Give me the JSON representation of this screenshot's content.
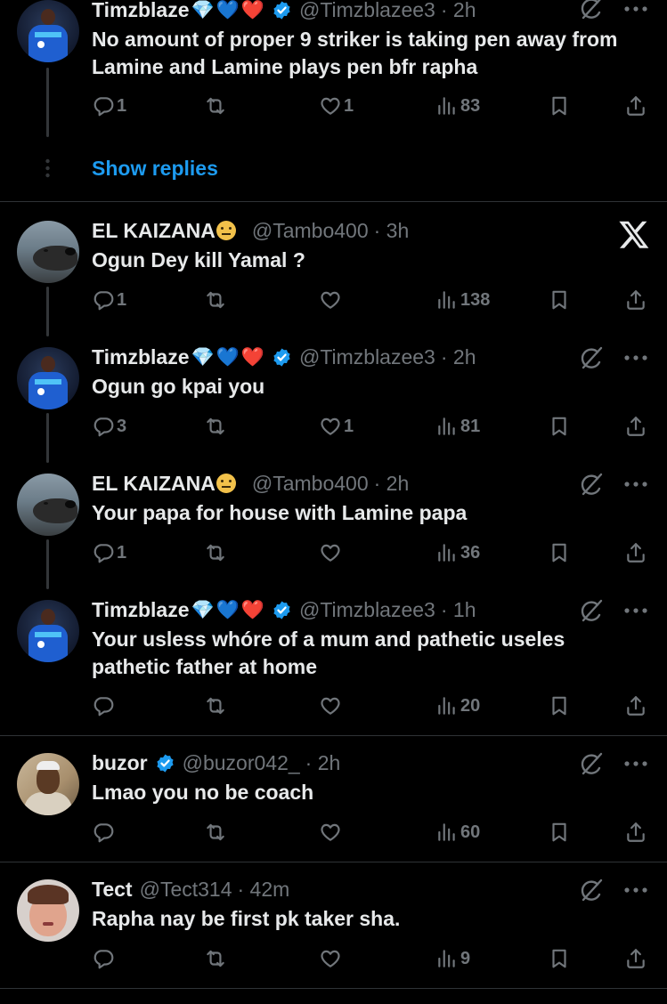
{
  "posts": [
    {
      "name": "Timzblaze",
      "emojis": [
        "💎",
        "💙",
        "❤️"
      ],
      "handle": "@Timzblazee3",
      "time": "· 2h",
      "text": "No amount of proper 9 striker is taking pen away from Lamine and Lamine plays pen bfr rapha",
      "replies": "1",
      "retweets": "",
      "likes": "1",
      "views": "83"
    },
    {
      "name": "EL KAIZANA",
      "emoji": "😐",
      "handle": "@Tambo400",
      "time": "· 3h",
      "text": "Ogun Dey kill Yamal ?",
      "replies": "1",
      "retweets": "",
      "likes": "",
      "views": "138"
    },
    {
      "name": "Timzblaze",
      "emojis": [
        "💎",
        "💙",
        "❤️"
      ],
      "handle": "@Timzblazee3",
      "time": "· 2h",
      "text": "Ogun go kpai you",
      "replies": "3",
      "retweets": "",
      "likes": "1",
      "views": "81"
    },
    {
      "name": "EL KAIZANA",
      "emoji": "😐",
      "handle": "@Tambo400",
      "time": "· 2h",
      "text": "Your papa for house with Lamine papa",
      "replies": "1",
      "retweets": "",
      "likes": "",
      "views": "36"
    },
    {
      "name": "Timzblaze",
      "emojis": [
        "💎",
        "💙",
        "❤️"
      ],
      "handle": "@Timzblazee3",
      "time": "· 1h",
      "text": "Your usless whóre of a mum and pathetic useles pathetic father at home",
      "replies": "",
      "retweets": "",
      "likes": "",
      "views": "20"
    },
    {
      "name": "buzor",
      "handle": "@buzor042_",
      "time": "· 2h",
      "text": "Lmao you no be coach",
      "replies": "",
      "retweets": "",
      "likes": "",
      "views": "60"
    },
    {
      "name": "Tect",
      "handle": "@Tect314",
      "time": "· 42m",
      "text": "Rapha nay be  first pk taker sha.",
      "replies": "",
      "retweets": "",
      "likes": "",
      "views": "9"
    }
  ],
  "show_replies_label": "Show replies",
  "colors": {
    "background": "#000000",
    "text": "#e7e9ea",
    "muted": "#71767b",
    "accent": "#1d9bf0",
    "divider": "#2f3336"
  },
  "icons": [
    "reply-icon",
    "retweet-icon",
    "like-icon",
    "views-icon",
    "bookmark-icon",
    "share-icon",
    "grok-icon",
    "more-icon",
    "verified-icon",
    "x-logo"
  ]
}
